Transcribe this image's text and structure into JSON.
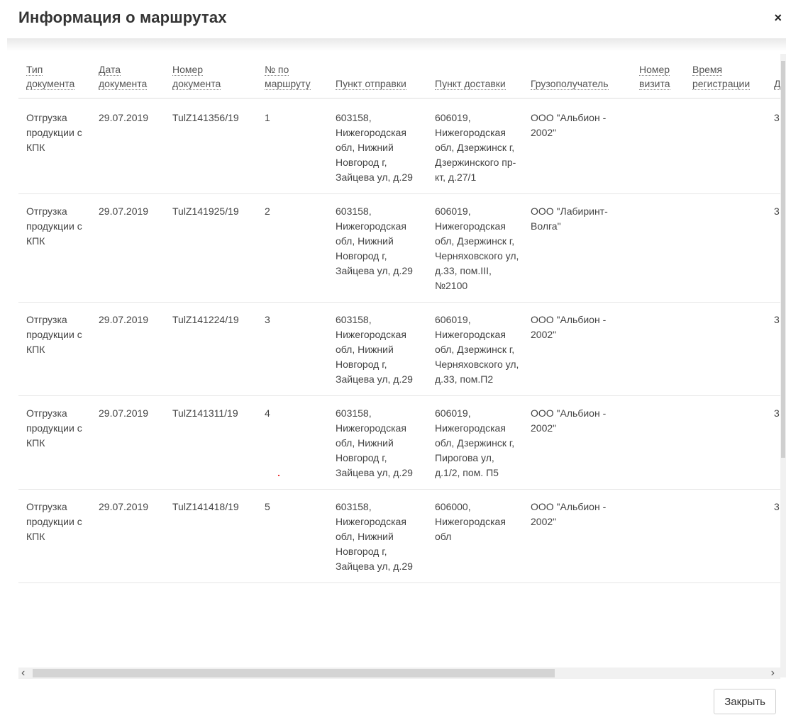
{
  "modal": {
    "title": "Информация о маршрутах",
    "close_glyph": "×",
    "close_button_label": "Закрыть"
  },
  "table": {
    "columns": [
      "Тип документа",
      "Дата документа",
      "Номер документа",
      "№ по маршруту",
      "Пункт отправки",
      "Пункт доставки",
      "Грузополучатель",
      "Номер визита",
      "Время регистрации",
      "Д"
    ],
    "rows": [
      [
        "Отгрузка продукции с КПК",
        "29.07.2019",
        "TulZ141356/19",
        "1",
        "603158, Нижегородская обл, Нижний Новгород г, Зайцева ул, д.29",
        "606019, Нижегородская обл, Дзержинск г, Дзержинского пр-кт, д.27/1",
        "ООО \"Альбион - 2002\"",
        "",
        "",
        "3"
      ],
      [
        "Отгрузка продукции с КПК",
        "29.07.2019",
        "TulZ141925/19",
        "2",
        "603158, Нижегородская обл, Нижний Новгород г, Зайцева ул, д.29",
        "606019, Нижегородская обл, Дзержинск г, Черняховского ул, д.33, пом.III, №2100",
        "ООО \"Лабиринт-Волга\"",
        "",
        "",
        "3"
      ],
      [
        "Отгрузка продукции с КПК",
        "29.07.2019",
        "TulZ141224/19",
        "3",
        "603158, Нижегородская обл, Нижний Новгород г, Зайцева ул, д.29",
        "606019, Нижегородская обл, Дзержинск г, Черняховского ул, д.33, пом.П2",
        "ООО \"Альбион - 2002\"",
        "",
        "",
        "3"
      ],
      [
        "Отгрузка продукции с КПК",
        "29.07.2019",
        "TulZ141311/19",
        "4",
        "603158, Нижегородская обл, Нижний Новгород г, Зайцева ул, д.29",
        "606019, Нижегородская обл, Дзержинск г, Пирогова ул, д.1/2, пом. П5",
        "ООО \"Альбион - 2002\"",
        "",
        "",
        "3"
      ],
      [
        "Отгрузка продукции с КПК",
        "29.07.2019",
        "TulZ141418/19",
        "5",
        "603158, Нижегородская обл, Нижний Новгород г, Зайцева ул, д.29",
        "606000, Нижегородская обл",
        "ООО \"Альбион - 2002\"",
        "",
        "",
        "3"
      ]
    ]
  },
  "scrollbar": {
    "left_arrow": "‹",
    "right_arrow": "›"
  }
}
